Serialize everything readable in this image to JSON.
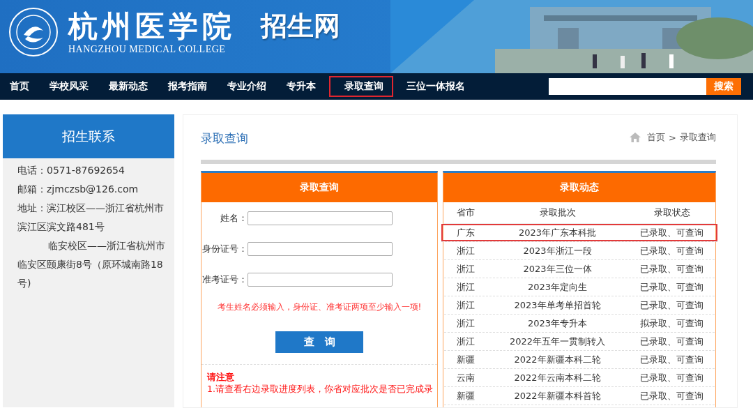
{
  "header": {
    "logo_title": "杭州医学院",
    "logo_subtitle": "HANGZHOU MEDICAL COLLEGE",
    "site_name": "招生网"
  },
  "nav": {
    "items": [
      {
        "label": "首页",
        "selected": false
      },
      {
        "label": "学校风采",
        "selected": false
      },
      {
        "label": "最新动态",
        "selected": false
      },
      {
        "label": "报考指南",
        "selected": false
      },
      {
        "label": "专业介绍",
        "selected": false
      },
      {
        "label": "专升本",
        "selected": false
      },
      {
        "label": "录取查询",
        "selected": true
      },
      {
        "label": "三位一体报名",
        "selected": false
      }
    ],
    "search_button": "搜索"
  },
  "sidebar": {
    "title": "招生联系",
    "lines": [
      {
        "label": "电话：",
        "text": "0571-87692654"
      },
      {
        "label": "邮箱：",
        "text": "zjmczsb@126.com"
      },
      {
        "label": "地址：",
        "text": "滨江校区——浙江省杭州市滨江区滨文路481号"
      },
      {
        "text": "临安校区——浙江省杭州市临安区颐康街8号（原环城南路18号)"
      }
    ]
  },
  "page": {
    "title": "录取查询",
    "breadcrumb": [
      "首页",
      "录取查询"
    ],
    "breadcrumb_separator": ">"
  },
  "query_form": {
    "title": "录取查询",
    "fields": [
      {
        "label": "姓名："
      },
      {
        "label": "身份证号："
      },
      {
        "label": "准考证号："
      }
    ],
    "hint": "考生姓名必须输入，身份证、准考证两项至少输入一项!",
    "submit": "查　询",
    "notice_title": "请注意",
    "notice_text": "1.请查看右边录取进度列表，你省对应批次是否已完成录"
  },
  "admissions": {
    "title": "录取动态",
    "columns": [
      "省市",
      "录取批次",
      "录取状态"
    ],
    "rows": [
      {
        "cells": [
          "广东",
          "2023年广东本科批",
          "已录取、可查询"
        ],
        "highlighted": true
      },
      {
        "cells": [
          "浙江",
          "2023年浙江一段",
          "已录取、可查询"
        ],
        "highlighted": false
      },
      {
        "cells": [
          "浙江",
          "2023年三位一体",
          "已录取、可查询"
        ],
        "highlighted": false
      },
      {
        "cells": [
          "浙江",
          "2023年定向生",
          "已录取、可查询"
        ],
        "highlighted": false
      },
      {
        "cells": [
          "浙江",
          "2023年单考单招首轮",
          "已录取、可查询"
        ],
        "highlighted": false
      },
      {
        "cells": [
          "浙江",
          "2023年专升本",
          "拟录取、可查询"
        ],
        "highlighted": false
      },
      {
        "cells": [
          "浙江",
          "2022年五年一贯制转入",
          "已录取、可查询"
        ],
        "highlighted": false
      },
      {
        "cells": [
          "新疆",
          "2022年新疆本科二轮",
          "已录取、可查询"
        ],
        "highlighted": false
      },
      {
        "cells": [
          "云南",
          "2022年云南本科二轮",
          "已录取、可查询"
        ],
        "highlighted": false
      },
      {
        "cells": [
          "新疆",
          "2022年新疆本科首轮",
          "已录取、可查询"
        ],
        "highlighted": false
      }
    ]
  }
}
